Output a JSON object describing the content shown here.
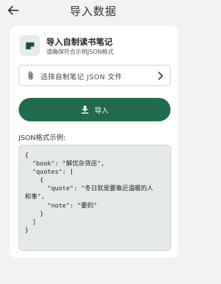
{
  "appbar": {
    "title": "导入数据"
  },
  "card": {
    "title": "导入自制读书笔记",
    "subtitle": "请确保符合示例JSON格式",
    "file_picker_text": "选择自制笔记 JSON 文件",
    "import_button": "导入",
    "example_label": "JSON格式示例:",
    "code_lines": [
      "{",
      "  \"book\": \"解忧杂货店\",",
      "  \"quotes\": [",
      "    {",
      "      \"quote\": \"冬日就是要靠近温暖的人",
      "和事\",",
      "      \"note\": \"要的\"",
      "    }",
      "  ]",
      "}"
    ]
  },
  "colors": {
    "accent": "#216b4c",
    "code_bg": "#e4e9e6",
    "page_bg": "#f2f2f2"
  },
  "icons": [
    "back-arrow-icon",
    "note-icon",
    "paperclip-icon",
    "chevron-right-icon",
    "download-icon"
  ]
}
